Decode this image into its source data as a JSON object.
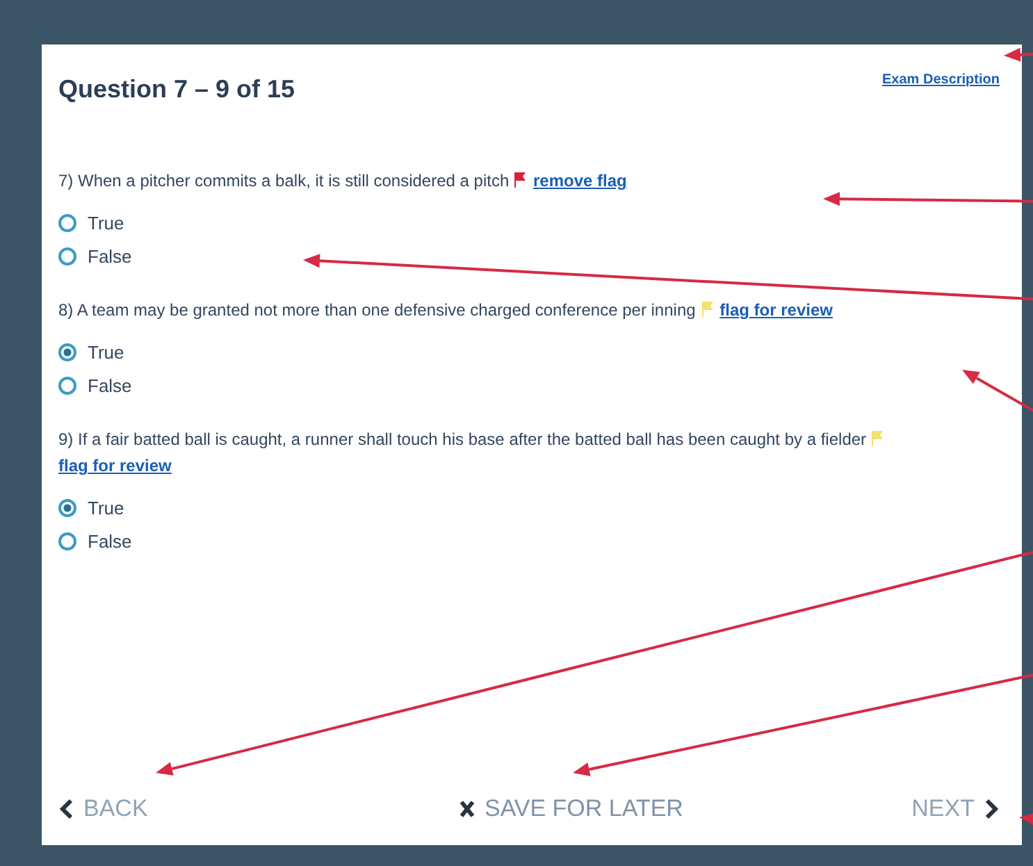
{
  "dialog": {
    "title": "Question 7 – 9 of 15",
    "link": "Exam Description"
  },
  "questions": [
    {
      "text": "7) When a pitcher commits a balk, it is still considered a pitch",
      "flagged": true,
      "flag_link": "remove flag",
      "options": [
        {
          "label": "True",
          "selected": false
        },
        {
          "label": "False",
          "selected": false
        }
      ]
    },
    {
      "text": "8) A team may be granted not more than one defensive charged conference per inning",
      "flagged": false,
      "flag_link": "flag for review",
      "options": [
        {
          "label": "True",
          "selected": true
        },
        {
          "label": "False",
          "selected": false
        }
      ]
    },
    {
      "text": "9) If a fair batted ball is caught, a runner shall touch his base after the batted ball has been caught by a fielder",
      "flagged": false,
      "flag_link": "flag for review",
      "options": [
        {
          "label": "True",
          "selected": true
        },
        {
          "label": "False",
          "selected": false
        }
      ]
    }
  ],
  "footer": {
    "back": "BACK",
    "save": "SAVE FOR LATER",
    "next": "NEXT"
  }
}
